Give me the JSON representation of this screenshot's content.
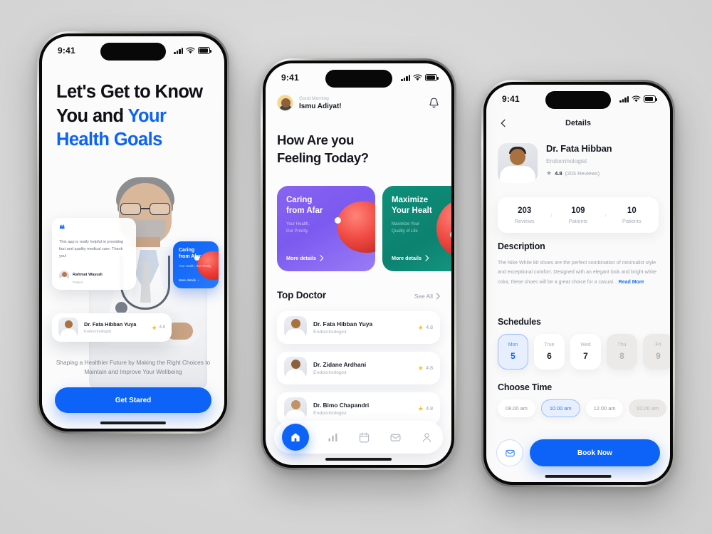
{
  "meta": {
    "accent_blue": "#0d63f7",
    "background": "#d7d7d7",
    "star_yellow": "#ffc01e"
  },
  "status_bar": {
    "time": "9:41"
  },
  "phone1": {
    "title_line1": "Let's Get to Know",
    "title_line2_plain": "You and ",
    "title_line2_accent": "Your",
    "title_line3_accent": "Health Goals",
    "testimonial": {
      "quote_mark": "“",
      "text": "This app is really helpful in providing fast and quality medical care. Thank you!",
      "author": "Rahmat Wayudi",
      "author_role": "Patient"
    },
    "mini_promo": {
      "title": "Caring\nfrom Afar",
      "subtitle": "Your Health, Our Priority",
      "more_label": "More details",
      "chevron": "›"
    },
    "doctor_chip": {
      "name": "Dr. Fata Hibban Yuya",
      "role": "Endocrinologist",
      "rating": "4.8"
    },
    "subtitle": "Shaping a Healthier Future by Making the Right Choices to Maintain and Improve Your Wellbeing",
    "cta_label": "Get Stared"
  },
  "phone2": {
    "header": {
      "greeting": "Good Morning",
      "user_name": "Ismu Adiyat!",
      "bell_icon": "bell-icon"
    },
    "headline_line1": "How Are you",
    "headline_line2": "Feeling Today?",
    "promos": [
      {
        "title_line1": "Caring",
        "title_line2": "from Afar",
        "sub_line1": "Your Health,",
        "sub_line2": "Our Priority",
        "more_label": "More details",
        "color": "#7b5af0"
      },
      {
        "title_line1": "Maximize",
        "title_line2": "Your Healt",
        "sub_line1": "Maximize Your",
        "sub_line2": "Quality of Life",
        "more_label": "More details",
        "color": "#0c8270"
      }
    ],
    "section": {
      "title": "Top Doctor",
      "see_all": "See All",
      "chevron": "›"
    },
    "doctors": [
      {
        "name": "Dr. Fata Hibban Yuya",
        "role": "Endocrinologist",
        "rating": "4.8",
        "skin": "#a9713f"
      },
      {
        "name": "Dr. Zidane Ardhani",
        "role": "Endocrinologist",
        "rating": "4.8",
        "skin": "#8d5f3a"
      },
      {
        "name": "Dr. Bimo Chapandri",
        "role": "Endocrinologist",
        "rating": "4.8",
        "skin": "#c39264"
      }
    ],
    "tabs": [
      {
        "icon": "home-icon",
        "active": true
      },
      {
        "icon": "stats-icon",
        "active": false
      },
      {
        "icon": "calendar-icon",
        "active": false
      },
      {
        "icon": "mail-icon",
        "active": false
      },
      {
        "icon": "profile-icon",
        "active": false
      }
    ]
  },
  "phone3": {
    "nav": {
      "back_icon": "chevron-left-icon",
      "title": "Details"
    },
    "doctor": {
      "name": "Dr. Fata Hibban",
      "role": "Endocrinologist",
      "rating": "4.8",
      "reviews_label": "(203 Reviews)"
    },
    "stats": [
      {
        "value": "203",
        "label": "Reviews"
      },
      {
        "value": "109",
        "label": "Patients"
      },
      {
        "value": "10",
        "label": "Patients"
      }
    ],
    "description": {
      "title": "Description",
      "text": "The Nike White 80 shoes are the perfect combination of minimalist style and exceptional comfort. Designed with an elegant look and bright white color, these shoes will be a great choice for a casual...",
      "read_more": "Read More"
    },
    "schedules": {
      "title": "Schedules",
      "days": [
        {
          "name": "Mon",
          "date": "5",
          "state": "selected"
        },
        {
          "name": "True",
          "date": "6",
          "state": "normal"
        },
        {
          "name": "Wed",
          "date": "7",
          "state": "normal"
        },
        {
          "name": "Thu",
          "date": "8",
          "state": "dim"
        },
        {
          "name": "Fri",
          "date": "9",
          "state": "dim"
        }
      ]
    },
    "choose_time": {
      "title": "Choose Time",
      "slots": [
        {
          "label": "08.00 am",
          "state": "normal"
        },
        {
          "label": "10.00 am",
          "state": "selected"
        },
        {
          "label": "12.00 am",
          "state": "normal"
        },
        {
          "label": "02.00 am",
          "state": "dim"
        }
      ]
    },
    "footer": {
      "mail_icon": "mail-icon",
      "book_label": "Book Now"
    }
  }
}
